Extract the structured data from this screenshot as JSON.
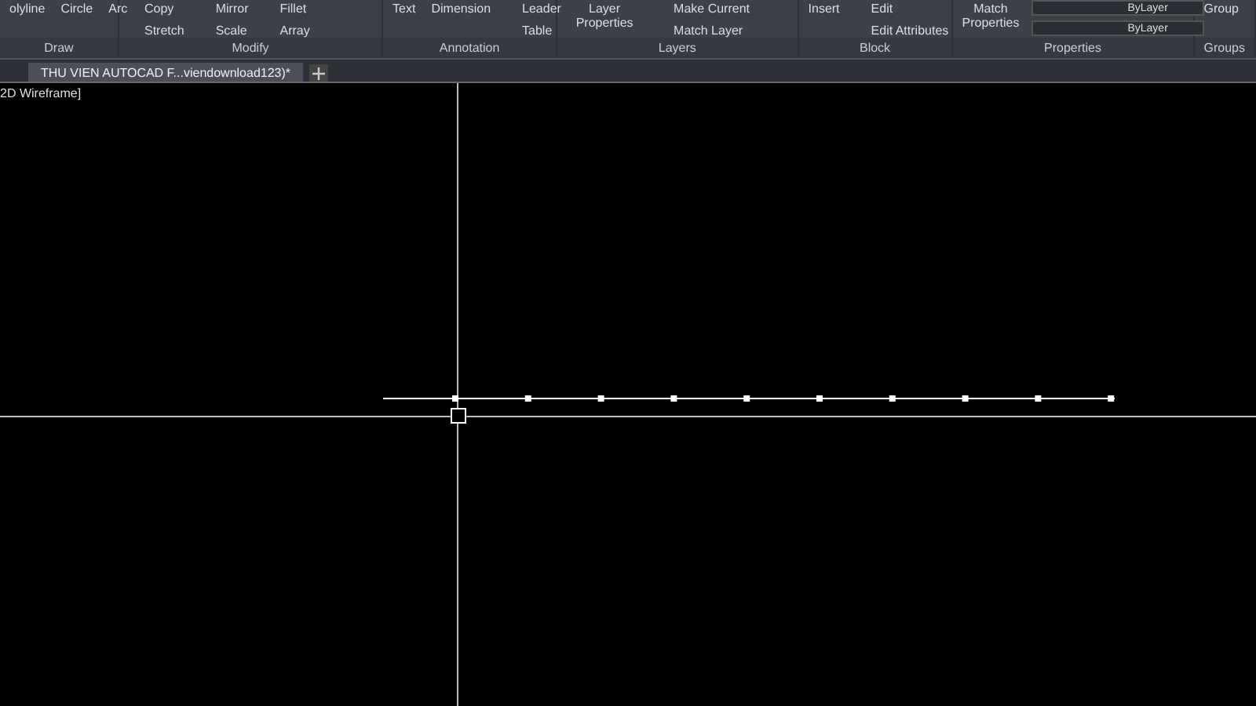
{
  "ribbon": {
    "panels": [
      {
        "label": "Draw",
        "tools": [
          {
            "kind": "large",
            "label": "olyline"
          },
          {
            "kind": "large",
            "label": "Circle"
          },
          {
            "kind": "large",
            "label": "Arc"
          }
        ]
      },
      {
        "label": "Modify",
        "tools": [
          {
            "kind": "pair",
            "top": "Copy",
            "bottom": "Stretch"
          },
          {
            "kind": "pair",
            "top": "Mirror",
            "bottom": "Scale"
          },
          {
            "kind": "pair",
            "top": "Fillet",
            "bottom": "Array"
          }
        ]
      },
      {
        "label": "Annotation",
        "tools": [
          {
            "kind": "large",
            "label": "Text"
          },
          {
            "kind": "large",
            "label": "Dimension"
          },
          {
            "kind": "pair",
            "top": "Leader",
            "bottom": "Table"
          }
        ]
      },
      {
        "label": "Layers",
        "tools": [
          {
            "kind": "large",
            "label": "Layer Properties"
          },
          {
            "kind": "pair",
            "top": "Make Current",
            "bottom": "Match Layer"
          }
        ]
      },
      {
        "label": "Block",
        "tools": [
          {
            "kind": "large",
            "label": "Insert"
          },
          {
            "kind": "pair",
            "top": "Edit",
            "bottom": "Edit Attributes"
          }
        ]
      },
      {
        "label": "Properties",
        "tools": [
          {
            "kind": "large",
            "label": "Match Properties"
          },
          {
            "kind": "dropdowns",
            "top": "ByLayer",
            "bottom": "ByLayer"
          }
        ]
      },
      {
        "label": "Groups",
        "tools": [
          {
            "kind": "large",
            "label": "Group"
          }
        ]
      }
    ]
  },
  "tabs": [
    {
      "label": "THU VIEN AUTOCAD F...viendownload123)*",
      "selected": true
    }
  ],
  "viewport": {
    "label": "2D Wireframe]"
  }
}
